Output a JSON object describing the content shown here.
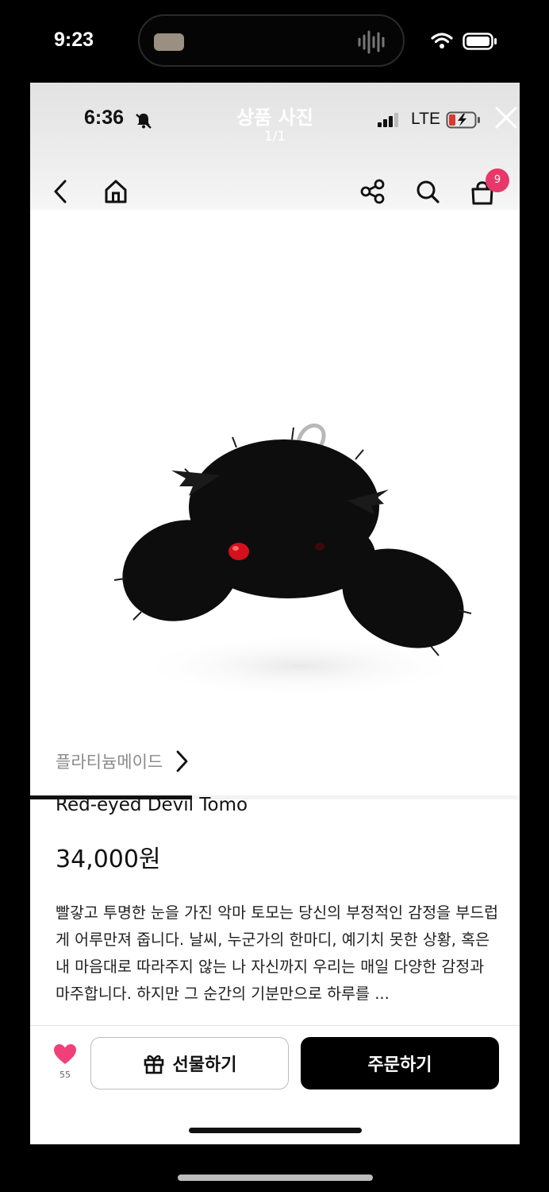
{
  "outer_status": {
    "time": "9:23"
  },
  "inner_status": {
    "time": "6:36",
    "network": "LTE"
  },
  "viewer": {
    "title": "상품 사진",
    "count": "1/1"
  },
  "nav": {
    "cart_badge": "9"
  },
  "image_progress": 0.33,
  "product": {
    "brand": "플라티늄메이드",
    "name": "Red-eyed Devil Tomo",
    "price": "34,000원",
    "description": "빨갛고 투명한 눈을 가진 악마 토모는 당신의 부정적인 감정을 부드럽게 어루만져 줍니다. 날씨, 누군가의 한마디, 예기치 못한 상황, 혹은 내 마음대로 따라주지 않는 나 자신까지 우리는 매일 다양한 감정과 마주합니다. 하지만 그 순간의 기분만으로 하루를 ..."
  },
  "actions": {
    "like_count": "55",
    "gift_label": "선물하기",
    "order_label": "주문하기"
  },
  "colors": {
    "badge": "#e8386a",
    "like": "#f0407a",
    "order_button": "#000000",
    "product_eye": "#d4101c"
  },
  "icons": [
    "wifi-icon",
    "battery-icon",
    "bell-slash-icon",
    "close-icon",
    "back-arrow-icon",
    "home-icon",
    "share-icon",
    "search-icon",
    "cart-icon",
    "chevron-right-icon",
    "heart-icon",
    "gift-icon"
  ]
}
